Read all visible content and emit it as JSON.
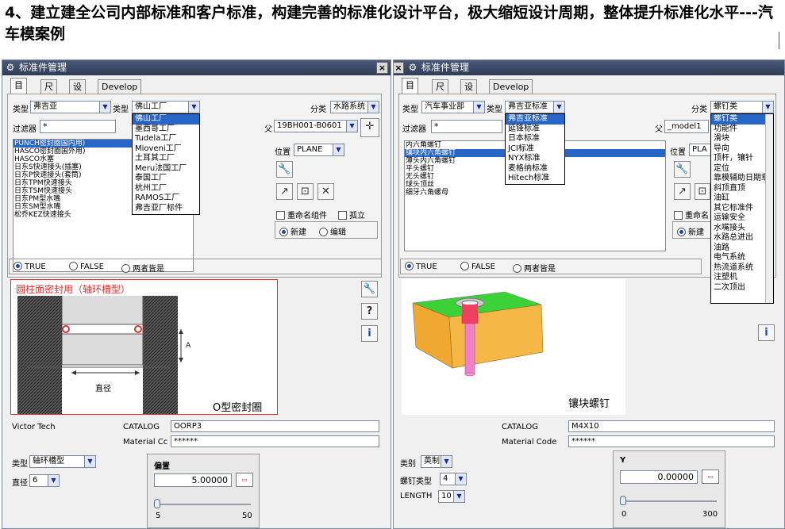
{
  "heading": "4、建立建全公司内部标准和客户标准，构建完善的标准化设计平台，极大缩短设计周期，整体提升标准化水平---汽车模案例",
  "colors": {
    "titlebar": "#2e3c56",
    "selection": "#2866c8",
    "sketch_red": "#e03030",
    "mold_green": "#3ad236",
    "mold_orange": "#f0a830",
    "pink": "#e040b0"
  },
  "left": {
    "title": "标准件管理",
    "tabs": [
      "目录",
      "尺寸",
      "设置",
      "Develop"
    ],
    "type_label": "类型",
    "type1": "弗吉亚",
    "type2": "佛山工厂",
    "cls_label": "分类",
    "cls": "水路系统",
    "filter_label": "过滤器",
    "filter": "*",
    "parent_label": "父",
    "parent": "19BH001-B0601",
    "list": [
      "PUNCH密封圈国内用)",
      "HASCO密封圈国外用)",
      "HASCO水塞",
      "日东S快速接头(插塞)",
      "日东P快速接头(套筒)",
      "日东TPM快速接头",
      "日东TSM快速接头",
      "日东PM型水嘴",
      "日东SM型水嘴",
      "松乔KEZ快速接头"
    ],
    "dropdown": [
      "佛山工厂",
      "墨西哥工厂",
      "Tudela工厂",
      "Mioveni工厂",
      "土耳其工厂",
      "Meru法国工厂",
      "泰国工厂",
      "杭州工厂",
      "RAMOS工厂",
      "弗吉亚厂标件"
    ],
    "pos_label": "位置",
    "pos": "PLANE",
    "rename": "重命名组件",
    "orphan": "孤立",
    "new": "新建",
    "edit": "编辑",
    "r_true": "TRUE",
    "r_false": "FALSE",
    "r_both": "两者皆是",
    "sketch_title": "圆柱面密封用（轴环槽型）",
    "sketch_a": "A",
    "sketch_dia": "直径",
    "sketch_caption": "O型密封圈",
    "vendor": "Victor Tech",
    "catalog_label": "CATALOG",
    "catalog": "OORP3",
    "mat_label": "Material Cc",
    "mat": "******",
    "sub_type_label": "类型",
    "sub_type": "轴环槽型",
    "dia_label": "直径",
    "dia": "6",
    "offset_label": "偏置",
    "offset": "5.00000",
    "slider_min": "5",
    "slider_max": "50",
    "slider_level": 0.0
  },
  "right": {
    "title": "标准件管理",
    "tabs": [
      "目录",
      "尺寸",
      "设置",
      "Develop"
    ],
    "type_label": "类型",
    "type1": "汽车事业部",
    "type2": "弗吉亚标准",
    "cls_label": "分类",
    "cls": "螺钉类",
    "filter_label": "过滤器",
    "filter": "*",
    "parent_label": "父",
    "parent": "_model1",
    "pos_label": "位置",
    "pos": "PLA",
    "list": [
      "内六角螺钉",
      "镶块内六角螺钉",
      "薄头内六角螺钉",
      "平头螺钉",
      "无头螺钉",
      "球头顶丝",
      "细牙六角螺母"
    ],
    "dropdown": [
      "弗吉亚标准",
      "延锋标准",
      "日本标准",
      "JCI标准",
      "NYX标准",
      "麦格纳标准",
      "Hitech标准"
    ],
    "cls_dropdown": [
      "螺钉类",
      "功能件",
      "滑块",
      "导向",
      "顶杆，镶针",
      "定位",
      "靠模辅助日期章",
      "斜顶直顶",
      "油缸",
      "其它标准件",
      "运输安全",
      "水嘴接头",
      "水路总进出",
      "油路",
      "电气系统",
      "热流道系统",
      "注塑机",
      "二次顶出"
    ],
    "rename": "重命名",
    "new": "新建",
    "r_true": "TRUE",
    "r_false": "FALSE",
    "r_both": "两者皆是",
    "caption": "镶块螺钉",
    "catalog_label": "CATALOG",
    "catalog": "M4X10",
    "mat_label": "Material Code",
    "mat": "******",
    "cat_label": "类别",
    "cat": "英制",
    "screw_label": "螺钉类型",
    "screw": "4",
    "len_label": "LENGTH",
    "len": "10",
    "y_label": "Y",
    "y_val": "0.00000",
    "slider_min": "0",
    "slider_max": "300",
    "slider_level": 0.0
  }
}
